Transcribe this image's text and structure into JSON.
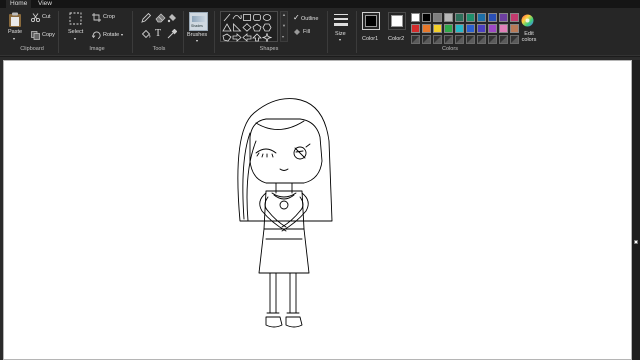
{
  "tabs": [
    {
      "label": "Home",
      "active": true
    },
    {
      "label": "View",
      "active": false
    }
  ],
  "clipboard": {
    "paste_label": "Paste",
    "cut_label": "Cut",
    "copy_label": "Copy",
    "group_label": "Clipboard"
  },
  "image": {
    "select_label": "Select",
    "crop_label": "Crop",
    "rotate_label": "Rotate",
    "group_label": "Image"
  },
  "tools": {
    "group_label": "Tools",
    "text_glyph": "T",
    "icons": [
      "pencil-icon",
      "fill-icon",
      "text-icon",
      "eraser-icon",
      "color-picker-icon",
      "magnifier-icon"
    ]
  },
  "brushes": {
    "label": "Brushes",
    "preview_text": "Shades"
  },
  "shapes": {
    "group_label": "Shapes",
    "outline_label": "Outline",
    "fill_label": "Fill",
    "check_glyph": "✓",
    "items": [
      "curve-icon",
      "line-icon",
      "rectangle-icon",
      "rounded-rectangle-icon",
      "oval-icon",
      "polygon-icon",
      "triangle-icon",
      "right-triangle-icon",
      "diamond-icon",
      "pentagon-icon",
      "hexagon-icon",
      "arrow-right-icon",
      "arrow-left-icon",
      "arrow-up-icon",
      "arrow-down-icon",
      "star-four-icon",
      "star-five-icon",
      "star-six-icon"
    ]
  },
  "size": {
    "label": "Size"
  },
  "colors": {
    "group_label": "Colors",
    "color1_label": "Color1",
    "color2_label": "Color2",
    "color1_value": "#000000",
    "color2_value": "#ffffff",
    "edit_label": "Edit colors",
    "palette_row1": [
      "#000000",
      "#7f7f7f",
      "#880015",
      "#ed1c24",
      "#ff7f27",
      "#fff200",
      "#22b14c",
      "#00a2e8",
      "#3f48cc",
      "#a349a4"
    ],
    "palette_row1_display": [
      "#ffffff",
      "#000000",
      "#7f7f7f",
      "#b8b8b8",
      "#2f6f5b",
      "#1f8f6c",
      "#1d6fa8",
      "#2a4fb5",
      "#6e3fa1",
      "#c23a6e"
    ],
    "palette_row2_display": [
      "#d42b2b",
      "#e8782a",
      "#f2cf2a",
      "#2fa84a",
      "#26b8c8",
      "#2a5fd0",
      "#4b3fc0",
      "#9c48c4",
      "#e07fb8",
      "#b97a57"
    ],
    "palette_row3_empty": 10
  },
  "accent": {
    "ribbon_bg": "#262626",
    "tab_bar_bg": "#151515",
    "workspace_bg": "#2b2b2b",
    "canvas_bg": "#ffffff"
  }
}
